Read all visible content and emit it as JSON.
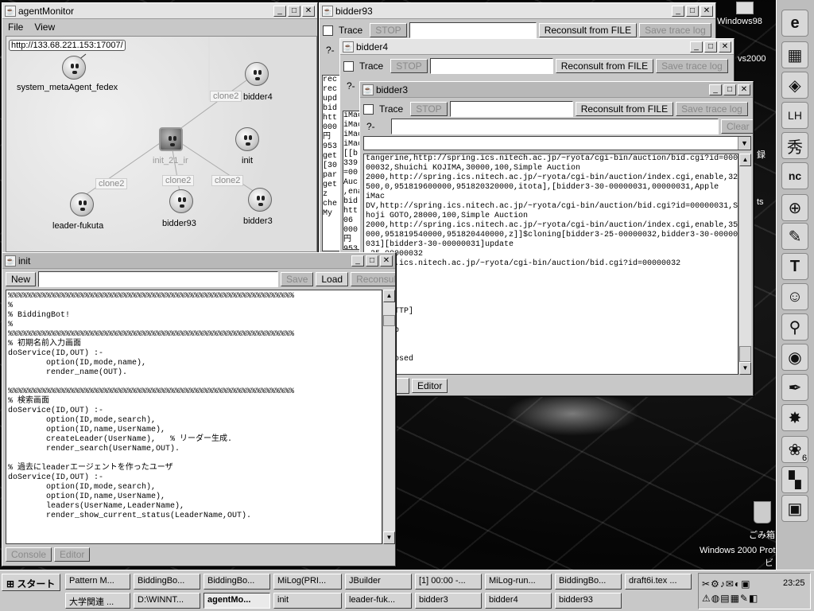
{
  "agentMonitor": {
    "title": "agentMonitor",
    "menu": [
      "File",
      "View"
    ],
    "url": "http://133.68.221.153:17007/",
    "agents": {
      "meta": "system_metaAgent_fedex",
      "bidder4": "bidder4",
      "init21": "init_21_ir",
      "init": "init",
      "leader": "leader-fukuta",
      "bidder93": "bidder93",
      "bidder3": "bidder3"
    },
    "clone_label": "clone2"
  },
  "bidder93": {
    "title": "bidder93",
    "trace": "Trace",
    "stop": "STOP",
    "reconsult": "Reconsult from FILE",
    "save_log": "Save trace log",
    "prompt": "?-",
    "log": "rec\nrec\nupd\nbid\nhtt\n000\n円\n953\nget\n[30\npar\nget\nz\nche\nMy"
  },
  "bidder4": {
    "title": "bidder4",
    "trace": "Trace",
    "stop": "STOP",
    "reconsult": "Reconsult from FILE",
    "save_log": "Save trace log",
    "prompt": "?-",
    "log": "iMac\niMac\niMac\niMac\n[[b\n339\n=00\nAuc\n,ena\nbid\nhtt\n06\n000\n円\n953"
  },
  "bidder3": {
    "title": "bidder3",
    "trace": "Trace",
    "stop": "STOP",
    "reconsult": "Reconsult from FILE",
    "save_log": "Save trace log",
    "prompt": "?-",
    "clear": "Clear",
    "editor": "Editor",
    "log": "tangerine,http://spring.ics.nitech.ac.jp/~ryota/cgi-bin/auction/bid.cgi?id=000\n00032,Shuichi KOJIMA,30000,100,Simple Auction\n2000,http://spring.ics.nitech.ac.jp/~ryota/cgi-bin/auction/index.cgi,enable,32\n500,0,951819600000,951820320000,itota],[bidder3-30-00000031,00000031,Apple\niMac\nDV,http://spring.ics.nitech.ac.jp/~ryota/cgi-bin/auction/bid.cgi?id=00000031,S\nhoji GOTO,28000,100,Simple Auction\n2000,http://spring.ics.nitech.ac.jp/~ryota/cgi-bin/auction/index.cgi,enable,35\n000,951819540000,951820440000,z]]$cloning[bidder3-25-00000032,bidder3-30-000000\n031][bidder3-30-00000031]update\n-25-00000032\nspring.ics.nitech.ac.jp/~ryota/cgi-bin/auction/bid.cgi?id=00000032\n2\n\n15593\n\nec @ HTTP]\nML1\nDataSub\n\n\n is closed"
  },
  "init": {
    "title": "init",
    "new": "New",
    "save": "Save",
    "load": "Load",
    "reconsult": "Reconsult",
    "console": "Console",
    "editor": "Editor",
    "code": "%%%%%%%%%%%%%%%%%%%%%%%%%%%%%%%%%%%%%%%%%%%%%%%%%%%%%%%%%%%%\n%\n% BiddingBot!\n%\n%%%%%%%%%%%%%%%%%%%%%%%%%%%%%%%%%%%%%%%%%%%%%%%%%%%%%%%%%%%%\n% 初期名前入力画面\ndoService(ID,OUT) :-\n        option(ID,mode,name),\n        render_name(OUT).\n\n%%%%%%%%%%%%%%%%%%%%%%%%%%%%%%%%%%%%%%%%%%%%%%%%%%%%%%%%%%%%\n% 検索画面\ndoService(ID,OUT) :-\n        option(ID,mode,search),\n        option(ID,name,UserName),\n        createLeader(UserName),   % リーダー生成.\n        render_search(UserName,OUT).\n\n% 過去にleaderエージェントを作ったユーザ\ndoService(ID,OUT) :-\n        option(ID,mode,search),\n        option(ID,name,UserName),\n        leaders(UserName,LeaderName),\n        render_show_current_status(LeaderName,OUT)."
  },
  "desktop": {
    "win98": "Windows98",
    "vs2000": "vs2000",
    "trash": "ごみ箱",
    "win2000": "Windows 2000 Prot",
    "letter_bi": "ビ",
    "side_ko": "録",
    "side_s": "ts",
    "num6": "6"
  },
  "taskbar": {
    "start": "スタート",
    "clock": "23:25",
    "row1": [
      "Pattern M...",
      "BiddingBo...",
      "BiddingBo...",
      "MiLog(PRI...",
      "JBuilder",
      "[1] 00:00 -...",
      "MiLog-run...",
      "BiddingBo...",
      "draft6i.tex ..."
    ],
    "row2": [
      "大学関連 ...",
      "D:\\WINNT...",
      "agentMo...",
      "init",
      "leader-fuk...",
      "bidder3",
      "bidder4",
      "bidder93"
    ]
  }
}
